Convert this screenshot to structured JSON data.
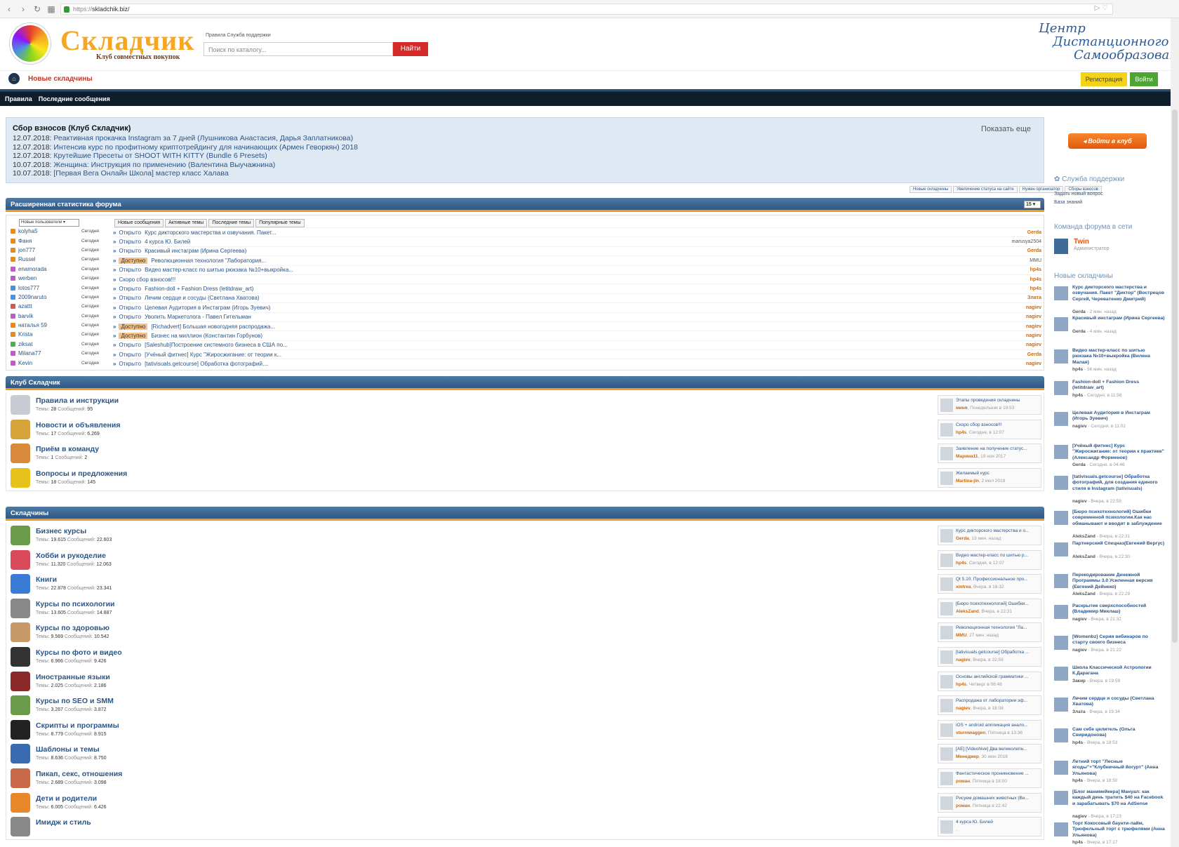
{
  "browser": {
    "url_prefix": "https://",
    "url_host": "skladchik.biz/"
  },
  "header": {
    "logo_title": "Складчик",
    "logo_sub": "Клуб совместных покупок",
    "top_links": "Правила  Служба поддержки",
    "search_placeholder": "Поиск по каталогу...",
    "search_button": "Найти",
    "banner_line1": "Центр",
    "banner_line2": "Дистанционного",
    "banner_line3": "Самообразования"
  },
  "subbar": {
    "new_label": "Новые складчины",
    "register": "Регистрация",
    "login": "Войти"
  },
  "nav": [
    "Правила",
    "Последние сообщения"
  ],
  "sbor": {
    "title": "Сбор взносов (Клуб Складчик)",
    "more": "Показать еще",
    "items": [
      {
        "date": "12.07.2018:",
        "text": "Реактивная прокачка Instagram за 7 дней (Лушникова Анастасия, Дарья Заплатникова)"
      },
      {
        "date": "12.07.2018:",
        "text": "Интенсив курс по профитному криптотрейдингу для начинающих (Армен Геворкян) 2018"
      },
      {
        "date": "12.07.2018:",
        "text": "Крутейшие Пресеты от SHOOT WITH KITTY (Bundle 6 Presets)"
      },
      {
        "date": "10.07.2018:",
        "text": "Женщина: Инструкция по применению (Валентина Выучажнина)"
      },
      {
        "date": "10.07.2018:",
        "text": "[Первая Вега Онлайн Школа] мастер класс Халава"
      }
    ],
    "tags": [
      "Новые складчины",
      "Увеличение статуса на сайте",
      "Нужен организатор",
      "Сборы взносов"
    ]
  },
  "stats": {
    "title": "Расширенная статистика форума",
    "count": "15",
    "user_select": "Новые пользователи",
    "tabs": [
      "Новые сообщения",
      "Активные темы",
      "Последние темы",
      "Популярные темы"
    ],
    "users": [
      {
        "name": "kolyha5",
        "when": "Сегодня",
        "color": "#e88a1a"
      },
      {
        "name": "Фаня",
        "when": "Сегодня",
        "color": "#e88a1a"
      },
      {
        "name": "jon777",
        "when": "Сегодня",
        "color": "#e88a1a"
      },
      {
        "name": "Russel",
        "when": "Сегодня",
        "color": "#e88a1a"
      },
      {
        "name": "enamorada",
        "when": "Сегодня",
        "color": "#c05ac6"
      },
      {
        "name": "werben",
        "when": "Сегодня",
        "color": "#c05ac6"
      },
      {
        "name": "lotos777",
        "when": "Сегодня",
        "color": "#4a90e2"
      },
      {
        "name": "2009naruto",
        "when": "Сегодня",
        "color": "#4a90e2"
      },
      {
        "name": "azattt",
        "when": "Сегодня",
        "color": "#e05050"
      },
      {
        "name": "barvik",
        "when": "Сегодня",
        "color": "#c05ac6"
      },
      {
        "name": "наталья 59",
        "when": "Сегодня",
        "color": "#e88a1a"
      },
      {
        "name": "Krista",
        "when": "Сегодня",
        "color": "#e88a1a"
      },
      {
        "name": "ziksat",
        "when": "Сегодня",
        "color": "#4ab04a"
      },
      {
        "name": "Milana77",
        "when": "Сегодня",
        "color": "#c05ac6"
      },
      {
        "name": "Kevin",
        "when": "Сегодня",
        "color": "#c05ac6"
      }
    ],
    "topics": [
      {
        "status": "Открыто",
        "title": "Курс дикторского мастерства и озвучания. Пакет...",
        "author": "Gerda"
      },
      {
        "status": "Открыто",
        "title": "4 курса Ю. Билей",
        "author": "marusya2504"
      },
      {
        "status": "Открыто",
        "title": "Красивый инстаграм (Ирина Сергеева)",
        "author": "Gerda"
      },
      {
        "status": "Доступно",
        "title": "Революционная технология \"Лаборатория...",
        "author": "MMU"
      },
      {
        "status": "Открыто",
        "title": "Видео мастер-класс по шитью рюкзака №10+выкройка...",
        "author": "hp4s"
      },
      {
        "status": "",
        "title": "Скоро сбор взносов!!!",
        "author": "hp4s"
      },
      {
        "status": "Открыто",
        "title": "Fashion-doll + Fashion Dress (letitdraw_art)",
        "author": "hp4s"
      },
      {
        "status": "Открыто",
        "title": "Лечим сердце и сосуды (Светлана Хватова)",
        "author": "Злата"
      },
      {
        "status": "Открыто",
        "title": "Целевая Аудитория в Инстаграм (Игорь Зуевич)",
        "author": "nagiev"
      },
      {
        "status": "Открыто",
        "title": "Уволить Маркетолога - Павел Гительман",
        "author": "nagiev"
      },
      {
        "status": "Доступно",
        "title": "[Richadvert] Большая новогодняя распродажа...",
        "author": "nagiev"
      },
      {
        "status": "Доступно",
        "title": "Бизнес на миллион (Константин Горбунов)",
        "author": "nagiev"
      },
      {
        "status": "Открыто",
        "title": "[Saleshub]Построение системного бизнеса в США по...",
        "author": "nagiev"
      },
      {
        "status": "Открыто",
        "title": "[Учёный фитнес] Курс \"Жиросжигание: от теории к...",
        "author": "Gerda"
      },
      {
        "status": "Открыто",
        "title": "[tativisuals.getcourse] Обработка фотографий,...",
        "author": "nagiev"
      }
    ]
  },
  "club": {
    "title": "Клуб Складчик",
    "forums": [
      {
        "name": "Правила и инструкции",
        "t": "28",
        "m": "95",
        "icon": "document-icon",
        "color": "#c8ccd2",
        "last_title": "Этапы проведения складчины",
        "last_author": "миня",
        "last_time": "Понедельник в 19:53"
      },
      {
        "name": "Новости и объявления",
        "t": "17",
        "m": "6.269",
        "icon": "antenna-icon",
        "color": "#d6a33a",
        "last_title": "Скоро сбор взносов!!!",
        "last_author": "hp4s",
        "last_time": "Сегодня, в 12:07"
      },
      {
        "name": "Приём в команду",
        "t": "1",
        "m": "2",
        "icon": "team-icon",
        "color": "#d88a3a",
        "last_title": "Заявление на получение статус...",
        "last_author": "Марина11",
        "last_time": "19 ноя 2017"
      },
      {
        "name": "Вопросы и предложения",
        "t": "18",
        "m": "145",
        "icon": "question-icon",
        "color": "#e6c21a",
        "last_title": "Желаемый курс",
        "last_author": "Martina-jin",
        "last_time": "2 июл 2018"
      }
    ]
  },
  "skl": {
    "title": "Складчины",
    "forums": [
      {
        "name": "Бизнес курсы",
        "t": "19.615",
        "m": "22.603",
        "icon": "money-icon",
        "color": "#6a9a4a",
        "last_title": "Курс дикторского мастерства и о...",
        "last_author": "Gerda",
        "last_time": "13 мин. назад"
      },
      {
        "name": "Хобби и рукоделие",
        "t": "11.320",
        "m": "12.063",
        "icon": "yarn-icon",
        "color": "#d94a5a",
        "last_title": "Видео мастер-класс по шитью р...",
        "last_author": "hp4s",
        "last_time": "Сегодня, в 12:07"
      },
      {
        "name": "Книги",
        "t": "22.878",
        "m": "23.341",
        "icon": "book-icon",
        "color": "#3a7bd5",
        "last_title": "Qt 5.10. Профессиональное про...",
        "last_author": "xintrea",
        "last_time": "Вчера, в 16:32"
      },
      {
        "name": "Курсы по психологии",
        "t": "13.605",
        "m": "14.887",
        "icon": "mask-icon",
        "color": "#888",
        "last_title": "[Бюро психотехнологий] Ошибки...",
        "last_author": "AleksZand",
        "last_time": "Вчера, в 22:31"
      },
      {
        "name": "Курсы по здоровью",
        "t": "9.569",
        "m": "10.542",
        "icon": "yoga-icon",
        "color": "#c89a6a",
        "last_title": "Революционная технология \"Ла...",
        "last_author": "MMU",
        "last_time": "27 мин. назад"
      },
      {
        "name": "Курсы по фото и видео",
        "t": "6.966",
        "m": "9.426",
        "icon": "camera-icon",
        "color": "#333",
        "last_title": "[tativisuals.getcourse] Обработка ...",
        "last_author": "nagiev",
        "last_time": "Вчера, в 22:59"
      },
      {
        "name": "Иностранные языки",
        "t": "2.025",
        "m": "2.186",
        "icon": "font-icon",
        "color": "#8a2a2a",
        "last_title": "Основы английской грамматики ...",
        "last_author": "hp4s",
        "last_time": "Четверг в 08:48"
      },
      {
        "name": "Курсы по SEO и SMM",
        "t": "3.267",
        "m": "3.872",
        "icon": "gauge-icon",
        "color": "#6a9a4a",
        "last_title": "Распродажа от лаборатории эф...",
        "last_author": "nagiev",
        "last_time": "Вчера, в 18:08"
      },
      {
        "name": "Скрипты и программы",
        "t": "8.779",
        "m": "8.915",
        "icon": "code-icon",
        "color": "#222",
        "last_title": "iOS + android аппликация анало...",
        "last_author": "sturmwaggen",
        "last_time": "Пятница в 13:36"
      },
      {
        "name": "Шаблоны и темы",
        "t": "8.636",
        "m": "8.750",
        "icon": "wordpress-icon",
        "color": "#3a6ab0",
        "last_title": "[AE] [Videohive] Два великолепн...",
        "last_author": "Менеджер",
        "last_time": "30 июн 2018"
      },
      {
        "name": "Пикап, секс, отношения",
        "t": "2.689",
        "m": "3.098",
        "icon": "couple-icon",
        "color": "#c86a4a",
        "last_title": "Фантастическое проникновение ...",
        "last_author": "роман",
        "last_time": "Пятница в 18:00"
      },
      {
        "name": "Дети и родители",
        "t": "6.005",
        "m": "6.426",
        "icon": "family-icon",
        "color": "#e8882a",
        "last_title": "Рисуем домашних животных (Ви...",
        "last_author": "роман",
        "last_time": "Пятница в 22:42"
      },
      {
        "name": "Имидж и стиль",
        "t": "",
        "m": "",
        "icon": "style-icon",
        "color": "#888",
        "last_title": "4 курса Ю. Билей",
        "last_author": "",
        "last_time": ""
      }
    ],
    "stat_t": "Темы:",
    "stat_m": "Сообщений:"
  },
  "side": {
    "club_btn": "Войти в клуб",
    "support": "Служба поддержки",
    "ask": "Задать новый вопрос",
    "kb": "База знаний",
    "team": "Команда форума в сети",
    "twin": "Twin",
    "twin_role": "Администратор",
    "new": "Новые складчины",
    "items": [
      {
        "t": "Курс дикторского мастерства и озвучания. Пакет \"Диктор\" (Вострецов Сергей, Череватенко Дмитрий)",
        "a": "Gerda",
        "w": "- 2 мин. назад"
      },
      {
        "t": "Красивый инстаграм (Ирина Сергеева)",
        "a": "Gerda",
        "w": "- 4 мин. назад"
      },
      {
        "t": "Видео мастер-класс по шитью рюкзака №10+выкройка (Вилена Малая)",
        "a": "hp4s",
        "w": "- 56 мин. назад"
      },
      {
        "t": "Fashion-doll + Fashion Dress (letitdraw_art)",
        "a": "hp4s",
        "w": "- Сегодня, в 11:56"
      },
      {
        "t": "Целевая Аудитория в Инстаграм (Игорь Зуевич)",
        "a": "nagiev",
        "w": "- Сегодня, в 11:02"
      },
      {
        "t": "[Учёный фитнес] Курс \"Жиросжигание: от теории к практике\" (Александр Форменов)",
        "a": "Gerda",
        "w": "- Сегодня, в 04:46"
      },
      {
        "t": "[tativisuals.getcourse] Обработка фотографий, для создания единого стиля в Instagram (tativisuals)",
        "a": "nagiev",
        "w": "- Вчера, в 22:59"
      },
      {
        "t": "[Бюро психотехнологий] Ошибки современной психологии.Как нас обманывают и вводят в заблуждение",
        "a": "AleksZand",
        "w": "- Вчера, в 22:31"
      },
      {
        "t": "Партнерский Спецназ(Евгений Вергус)",
        "a": "AleksZand",
        "w": "- Вчера, в 22:30"
      },
      {
        "t": "Перекодирование Денежной Программы 3.0 Усиленная версия (Евгений Дейнеко)",
        "a": "AleksZand",
        "w": "- Вчера, в 22:29"
      },
      {
        "t": "Раскрытие сверхспособностей (Владимир Миклаш)",
        "a": "nagiev",
        "w": "- Вчера, в 21:32"
      },
      {
        "t": "[Womenbz] Серия вебинаров по старту своего бизнеса",
        "a": "nagiev",
        "w": "- Вчера, в 21:22"
      },
      {
        "t": "Школа Классической Астрологии К.Дарагана",
        "a": "Закир",
        "w": "- Вчера, в 19:59"
      },
      {
        "t": "Лечим сердце и сосуды (Светлана Хватова)",
        "a": "Злата",
        "w": "- Вчера, в 19:34"
      },
      {
        "t": "Сам себе целитель (Ольга Свиридонова)",
        "a": "hp4s",
        "w": "- Вчера, в 18:53"
      },
      {
        "t": "Летний торт \"Лесные ягоды\"+\"Клубничный йогурт\" (Анна Ульянова)",
        "a": "hp4s",
        "w": "- Вчера, в 18:50"
      },
      {
        "t": "[Блог манимейкера] Мануал: как каждый день тратить $40 на Facebook и зарабатывать $70 на AdSense",
        "a": "nagiev",
        "w": "- Вчера, в 17:23"
      },
      {
        "t": "Торт Кокосовый баунти-лайм, Трюфельный торт с трюфелями (Анна Ульянова)",
        "a": "hp4s",
        "w": "- Вчера, в 17:17"
      }
    ]
  }
}
